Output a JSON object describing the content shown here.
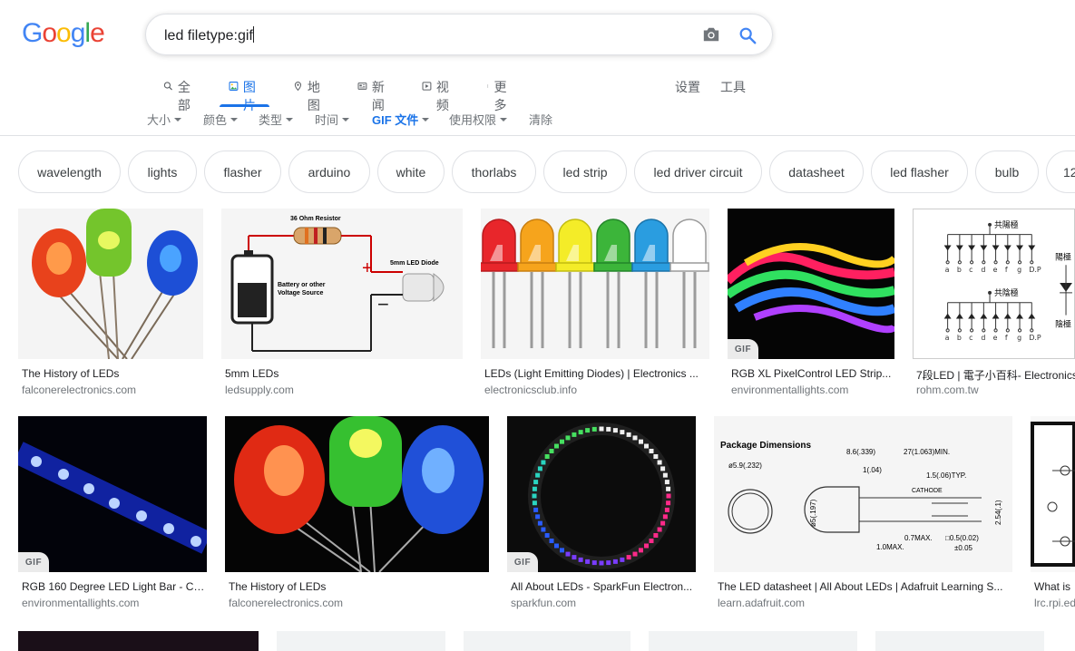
{
  "logo": {
    "letters": [
      "G",
      "o",
      "o",
      "g",
      "l",
      "e"
    ],
    "colors": [
      "#4285F4",
      "#EA4335",
      "#FBBC05",
      "#4285F4",
      "#34A853",
      "#EA4335"
    ]
  },
  "search": {
    "query": "led filetype:gif"
  },
  "tabs": [
    {
      "label": "全部",
      "icon": "search-icon"
    },
    {
      "label": "图片",
      "icon": "image-icon"
    },
    {
      "label": "地图",
      "icon": "map-pin-icon"
    },
    {
      "label": "新闻",
      "icon": "news-icon"
    },
    {
      "label": "视频",
      "icon": "play-icon"
    },
    {
      "label": "更多",
      "icon": "more-vert-icon"
    }
  ],
  "settings_label": "设置",
  "tools_label": "工具",
  "filters": [
    {
      "label": "大小"
    },
    {
      "label": "颜色"
    },
    {
      "label": "类型"
    },
    {
      "label": "时间"
    },
    {
      "label": "GIF 文件"
    },
    {
      "label": "使用权限"
    },
    {
      "label": "清除"
    }
  ],
  "chips": [
    "wavelength",
    "lights",
    "flasher",
    "arduino",
    "white",
    "thorlabs",
    "led strip",
    "led driver circuit",
    "datasheet",
    "led flasher",
    "bulb",
    "12"
  ],
  "results": [
    {
      "title": "The History of LEDs",
      "domain": "falconerelectronics.com"
    },
    {
      "title": "5mm LEDs",
      "domain": "ledsupply.com"
    },
    {
      "title": "LEDs (Light Emitting Diodes) | Electronics ...",
      "domain": "electronicsclub.info"
    },
    {
      "title": "RGB XL PixelControl LED Strip...",
      "domain": "environmentallights.com",
      "gif": "GIF"
    },
    {
      "title": "7段LED | 電子小百科- Electronics",
      "domain": "rohm.com.tw"
    },
    {
      "title": "RGB 160 Degree LED Light Bar - Cu...",
      "domain": "environmentallights.com",
      "gif": "GIF"
    },
    {
      "title": "The History of LEDs",
      "domain": "falconerelectronics.com"
    },
    {
      "title": "All About LEDs - SparkFun Electron...",
      "domain": "sparkfun.com",
      "gif": "GIF"
    },
    {
      "title": "The LED datasheet | All About LEDs | Adafruit Learning S...",
      "domain": "learn.adafruit.com"
    },
    {
      "title": "What is",
      "domain": "lrc.rpi.ed"
    }
  ],
  "image_text": {
    "resistor": "36 Ohm Resistor",
    "diode": "5mm LED Diode",
    "battery": [
      "Battery or other",
      "Voltage Source"
    ],
    "plus": "+",
    "minus": "−",
    "common_anode": "共陽極",
    "common_cathode": "共陰極",
    "segments": [
      "a",
      "b",
      "c",
      "d",
      "e",
      "f",
      "g",
      "D.P"
    ],
    "anode_side": "陽極",
    "cathode_side": "陰極",
    "pkg_title": "Package Dimensions",
    "pkg_labels": [
      "ø5.9(.232)",
      "8.6(.339)",
      "27(1.063)MIN.",
      "1(.04)",
      "1.5(.06)TYP.",
      "CATHODE",
      "ø5(.197)",
      "2.54(.1)",
      "0.7MAX.",
      "□0.5(0.02)",
      "±0.05",
      "1.0MAX."
    ]
  }
}
